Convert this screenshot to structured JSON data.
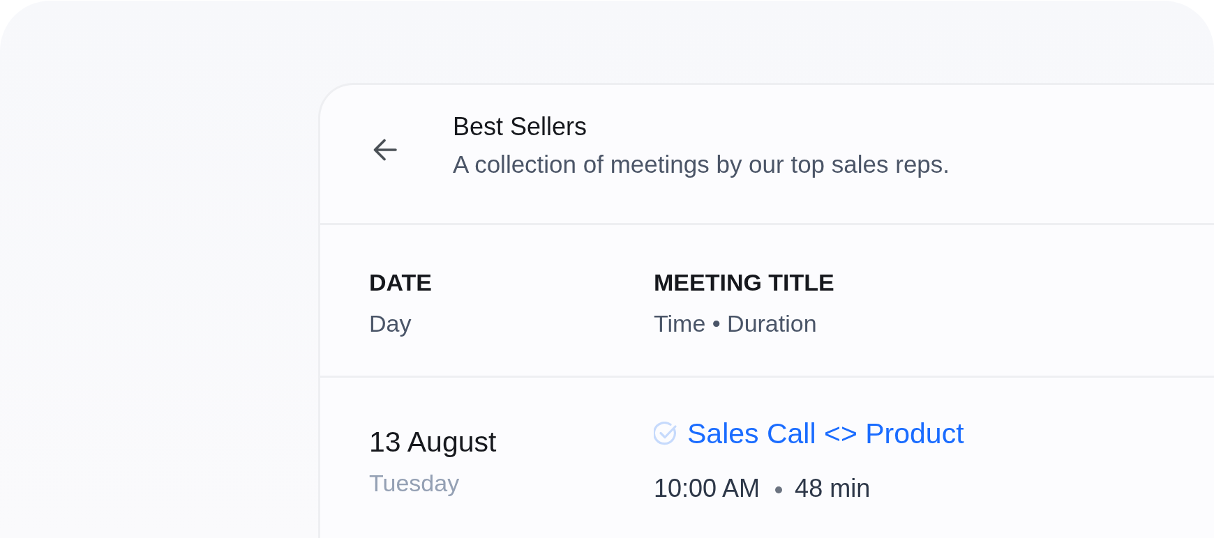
{
  "header": {
    "title": "Best Sellers",
    "description": "A collection of meetings by our top sales reps."
  },
  "table": {
    "columns": [
      {
        "heading": "DATE",
        "subheading": "Day"
      },
      {
        "heading": "MEETING TITLE",
        "subheading": "Time • Duration"
      }
    ],
    "rows": [
      {
        "date": "13 August",
        "weekday": "Tuesday",
        "title": "Sales Call <> Product",
        "completed": true,
        "time": "10:00 AM",
        "duration": "48 min"
      }
    ]
  }
}
